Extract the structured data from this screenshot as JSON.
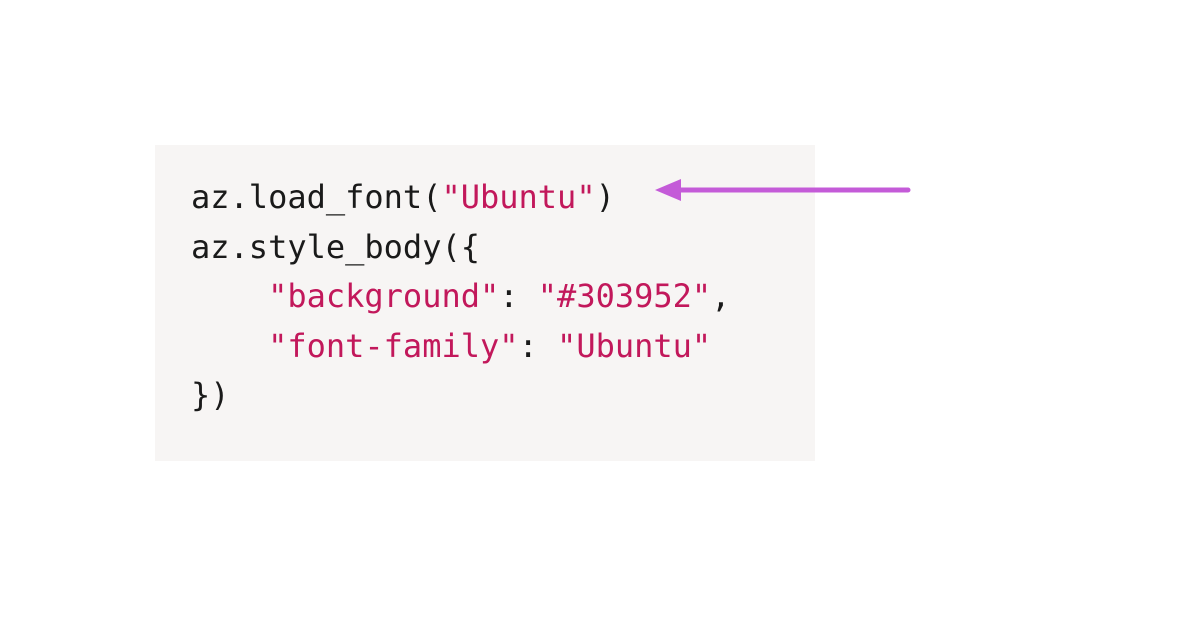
{
  "code": {
    "line1": {
      "p1": "az.load_font(",
      "p2": "\"Ubuntu\"",
      "p3": ")"
    },
    "line2": "",
    "line3": {
      "p1": "az.style_body({"
    },
    "line4": {
      "indent": "    ",
      "p1": "\"background\"",
      "p2": ": ",
      "p3": "\"#303952\"",
      "p4": ","
    },
    "line5": {
      "indent": "    ",
      "p1": "\"font-family\"",
      "p2": ": ",
      "p3": "\"Ubuntu\""
    },
    "line6": {
      "p1": "})"
    }
  },
  "colors": {
    "arrow": "#c45bd8"
  }
}
